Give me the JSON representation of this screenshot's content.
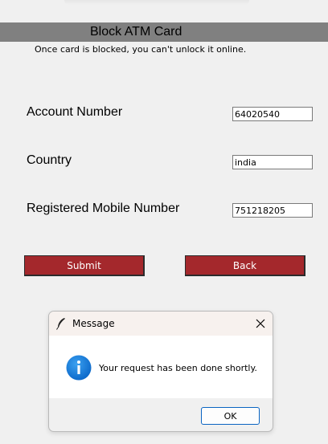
{
  "header": {
    "title": "Block ATM Card"
  },
  "subtitle": "Once card is blocked, you can't unlock it online.",
  "form": {
    "account_number": {
      "label": "Account Number",
      "value": "64020540"
    },
    "country": {
      "label": "Country",
      "value": "india"
    },
    "mobile": {
      "label": "Registered Mobile Number",
      "value": "751218205"
    }
  },
  "buttons": {
    "submit": "Submit",
    "back": "Back"
  },
  "dialog": {
    "title": "Message",
    "message": "Your request has been done shortly.",
    "ok": "OK",
    "title_icon": "feather-icon",
    "message_icon": "info-icon"
  },
  "colors": {
    "header_bar": "#808080",
    "button": "#a4282c",
    "info": "#1a7fd9"
  }
}
